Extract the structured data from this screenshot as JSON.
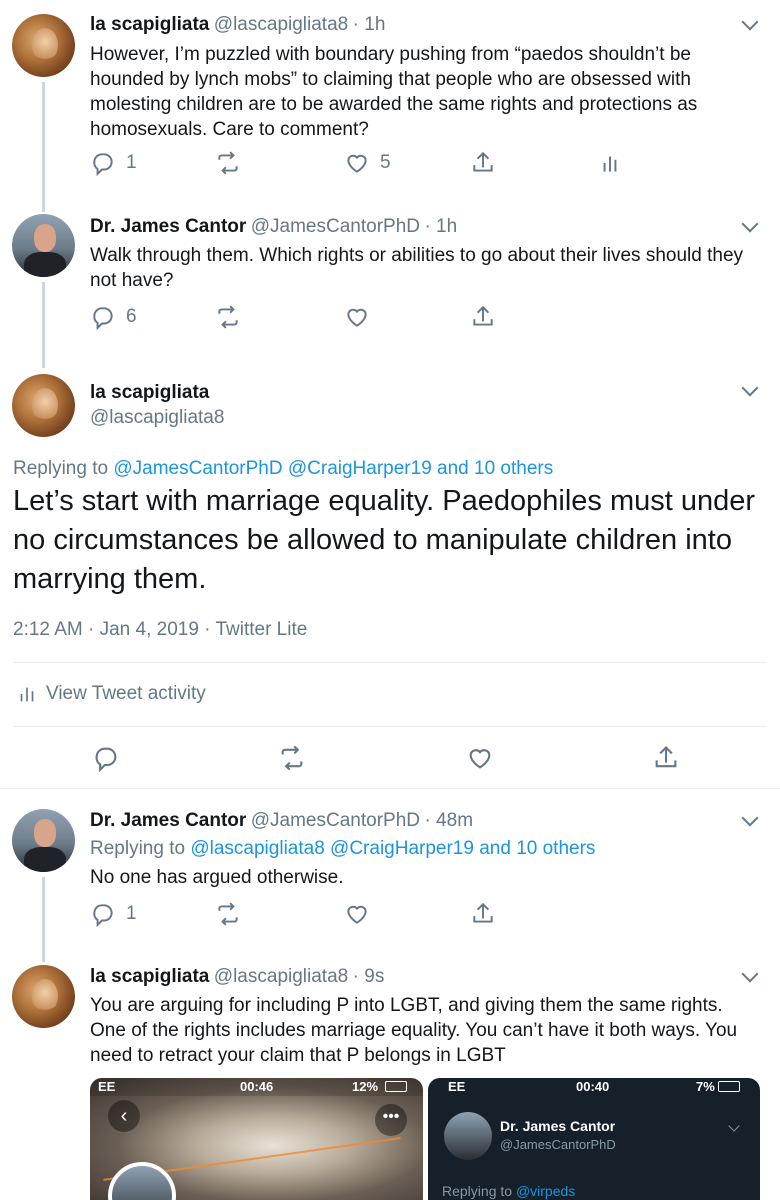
{
  "tweets": [
    {
      "name": "la scapigliata",
      "handle": "@lascapigliata8",
      "time": "· 1h",
      "text": "However, I’m puzzled with boundary pushing from “paedos shouldn’t be hounded by lynch mobs” to claiming that people who are obsessed with molesting children are to be awarded the same rights and protections as homosexuals. Care to comment?",
      "replies": "1",
      "likes": "5"
    },
    {
      "name": "Dr. James Cantor",
      "handle": "@JamesCantorPhD",
      "time": "· 1h",
      "text": "Walk through them.  Which rights or abilities to go about their lives should they not have?",
      "replies": "6"
    },
    {
      "name": "Dr. James Cantor",
      "handle": "@JamesCantorPhD",
      "time": "· 48m",
      "replying_prefix": "Replying to",
      "replying_links": "@lascapigliata8 @CraigHarper19 and 10 others",
      "text": "No one has argued otherwise.",
      "replies": "1"
    },
    {
      "name": "la scapigliata",
      "handle": "@lascapigliata8",
      "time": "· 9s",
      "text": "You are arguing for including P into LGBT, and giving them the same rights. One of the rights includes marriage equality. You can’t have it both ways. You need to retract your claim that P belongs in LGBT"
    }
  ],
  "focus": {
    "name": "la scapigliata",
    "handle": "@lascapigliata8",
    "replying_prefix": "Replying to",
    "replying_links": "@JamesCantorPhD @CraigHarper19 and 10 others",
    "text": "Let’s start with marriage equality. Paedophiles must under no circumstances be allowed to manipulate children into marrying them.",
    "timestamp": "2:12 AM · Jan 4, 2019 · Twitter Lite",
    "activity_label": "View Tweet activity"
  },
  "embed_left": {
    "carrier": "EE",
    "time": "00:46",
    "battery": "12%"
  },
  "embed_right": {
    "carrier": "EE",
    "time": "00:40",
    "battery": "7%",
    "name": "Dr. James Cantor",
    "handle": "@JamesCantorPhD",
    "replying": "Replying to",
    "replying_link": "@virpeds"
  },
  "colors": {
    "text": "#14171a",
    "secondary": "#657786",
    "link": "#1b95e0",
    "divider": "#e6ecf0"
  }
}
